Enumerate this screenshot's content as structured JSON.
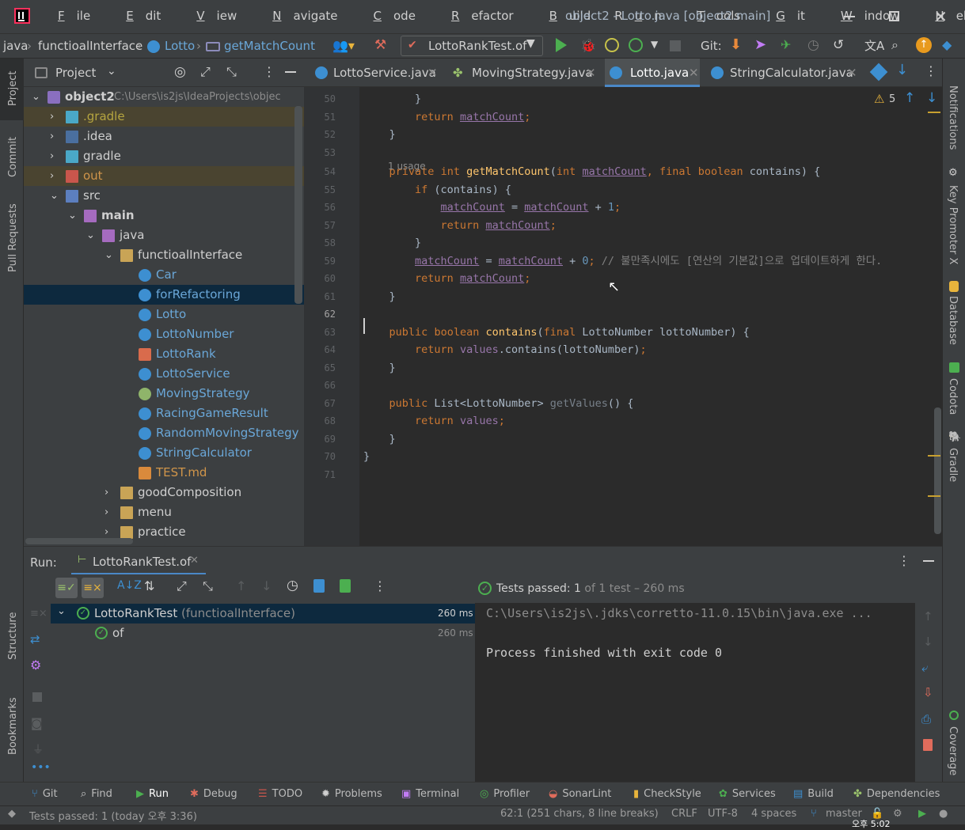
{
  "window": {
    "title": "object2 - Lotto.java [object2.main]",
    "menu": [
      {
        "pre": "",
        "u": "F",
        "post": "ile"
      },
      {
        "pre": "",
        "u": "E",
        "post": "dit"
      },
      {
        "pre": "",
        "u": "V",
        "post": "iew"
      },
      {
        "pre": "",
        "u": "N",
        "post": "avigate"
      },
      {
        "pre": "",
        "u": "C",
        "post": "ode"
      },
      {
        "pre": "",
        "u": "R",
        "post": "efactor"
      },
      {
        "pre": "",
        "u": "B",
        "post": "uild"
      },
      {
        "pre": "R",
        "u": "u",
        "post": "n"
      },
      {
        "pre": "",
        "u": "T",
        "post": "ools"
      },
      {
        "pre": "",
        "u": "G",
        "post": "it"
      },
      {
        "pre": "",
        "u": "W",
        "post": "indow"
      },
      {
        "pre": "",
        "u": "H",
        "post": "elp"
      }
    ]
  },
  "navbar": {
    "crumbs": [
      "java",
      "functioalInterface",
      "Lotto",
      "getMatchCount"
    ],
    "run_config": "LottoRankTest.of",
    "git_label": "Git:"
  },
  "left_strip": {
    "project": "Project",
    "commit": "Commit",
    "pull_requests": "Pull Requests",
    "structure": "Structure",
    "bookmarks": "Bookmarks"
  },
  "right_strip": {
    "notifications": "Notifications",
    "key_promoter": "Key Promoter X",
    "database": "Database",
    "codota": "Codota",
    "gradle": "Gradle",
    "coverage": "Coverage"
  },
  "project": {
    "title": "Project",
    "tree": [
      {
        "label": "object2",
        "suffix": "C:\\Users\\is2js\\IdeaProjects\\objec",
        "bold": true,
        "indent": 0,
        "arrow": "down",
        "icon": "module",
        "color": "#cfcfcf"
      },
      {
        "label": ".gradle",
        "indent": 1,
        "arrow": "right",
        "icon": "folder-teal",
        "color": "#b5a540",
        "excluded": true
      },
      {
        "label": ".idea",
        "indent": 1,
        "arrow": "right",
        "icon": "folder-idea",
        "color": "#cfcfcf"
      },
      {
        "label": "gradle",
        "indent": 1,
        "arrow": "right",
        "icon": "folder-teal",
        "color": "#cfcfcf"
      },
      {
        "label": "out",
        "indent": 1,
        "arrow": "right",
        "icon": "folder-red",
        "color": "#d0954a",
        "excluded": true
      },
      {
        "label": "src",
        "indent": 1,
        "arrow": "down",
        "icon": "folder-src",
        "color": "#cfcfcf"
      },
      {
        "label": "main",
        "indent": 2,
        "arrow": "down",
        "icon": "folder-main",
        "color": "#cfcfcf",
        "bold": true
      },
      {
        "label": "java",
        "indent": 3,
        "arrow": "down",
        "icon": "folder-java",
        "color": "#cfcfcf"
      },
      {
        "label": "functioalInterface",
        "indent": 4,
        "arrow": "down",
        "icon": "folder",
        "color": "#cfcfcf"
      },
      {
        "label": "Car",
        "indent": 5,
        "icon": "class",
        "color": "#6aa7d8"
      },
      {
        "label": "forRefactoring",
        "indent": 5,
        "icon": "class",
        "color": "#6aa7d8",
        "selected": true
      },
      {
        "label": "Lotto",
        "indent": 5,
        "icon": "class",
        "color": "#6aa7d8"
      },
      {
        "label": "LottoNumber",
        "indent": 5,
        "icon": "class",
        "color": "#6aa7d8"
      },
      {
        "label": "LottoRank",
        "indent": 5,
        "icon": "enum",
        "color": "#6aa7d8"
      },
      {
        "label": "LottoService",
        "indent": 5,
        "icon": "class",
        "color": "#6aa7d8"
      },
      {
        "label": "MovingStrategy",
        "indent": 5,
        "icon": "interface",
        "color": "#6aa7d8"
      },
      {
        "label": "RacingGameResult",
        "indent": 5,
        "icon": "class",
        "color": "#6aa7d8"
      },
      {
        "label": "RandomMovingStrategy",
        "indent": 5,
        "icon": "class",
        "color": "#6aa7d8"
      },
      {
        "label": "StringCalculator",
        "indent": 5,
        "icon": "class",
        "color": "#6aa7d8"
      },
      {
        "label": "TEST.md",
        "indent": 5,
        "icon": "md",
        "color": "#d0954a"
      },
      {
        "label": "goodComposition",
        "indent": 4,
        "arrow": "right",
        "icon": "folder",
        "color": "#cfcfcf"
      },
      {
        "label": "menu",
        "indent": 4,
        "arrow": "right",
        "icon": "folder",
        "color": "#cfcfcf"
      },
      {
        "label": "practice",
        "indent": 4,
        "arrow": "right",
        "icon": "folder",
        "color": "#cfcfcf"
      }
    ]
  },
  "editor": {
    "tabs": [
      {
        "label": "LottoService.java",
        "icon": "class",
        "active": false
      },
      {
        "label": "MovingStrategy.java",
        "icon": "interface",
        "active": false
      },
      {
        "label": "Lotto.java",
        "icon": "class",
        "active": true
      },
      {
        "label": "StringCalculator.java",
        "icon": "class",
        "active": false
      }
    ],
    "warnings": "5",
    "usage_hint": "1 usage",
    "lines": [
      {
        "n": "50",
        "tokens": [
          [
            "        }",
            ""
          ]
        ]
      },
      {
        "n": "51",
        "tokens": [
          [
            "        ",
            ""
          ],
          [
            "return",
            "kw"
          ],
          [
            " ",
            ""
          ],
          [
            "matchCount",
            "ul"
          ],
          [
            ";",
            "kw"
          ]
        ]
      },
      {
        "n": "52",
        "tokens": [
          [
            "    }",
            ""
          ]
        ]
      },
      {
        "n": "53",
        "tokens": []
      },
      {
        "n": "54",
        "tokens": [
          [
            "    ",
            ""
          ],
          [
            "private",
            "kw"
          ],
          [
            " ",
            ""
          ],
          [
            "int",
            "kw"
          ],
          [
            " ",
            ""
          ],
          [
            "getMatchCount",
            "fn"
          ],
          [
            "(",
            ""
          ],
          [
            "int",
            "kw"
          ],
          [
            " ",
            ""
          ],
          [
            "matchCount",
            "ul"
          ],
          [
            ", ",
            "kw"
          ],
          [
            "final",
            "kw"
          ],
          [
            " ",
            ""
          ],
          [
            "boolean",
            "kw"
          ],
          [
            " contains) {",
            ""
          ]
        ]
      },
      {
        "n": "55",
        "tokens": [
          [
            "        ",
            ""
          ],
          [
            "if",
            "kw"
          ],
          [
            " (contains) {",
            ""
          ]
        ]
      },
      {
        "n": "56",
        "tokens": [
          [
            "            ",
            ""
          ],
          [
            "matchCount",
            "ul"
          ],
          [
            " = ",
            ""
          ],
          [
            "matchCount",
            "ul"
          ],
          [
            " + ",
            ""
          ],
          [
            "1",
            "num"
          ],
          [
            ";",
            "kw"
          ]
        ]
      },
      {
        "n": "57",
        "tokens": [
          [
            "            ",
            ""
          ],
          [
            "return",
            "kw"
          ],
          [
            " ",
            ""
          ],
          [
            "matchCount",
            "ul"
          ],
          [
            ";",
            "kw"
          ]
        ]
      },
      {
        "n": "58",
        "tokens": [
          [
            "        }",
            ""
          ]
        ]
      },
      {
        "n": "59",
        "tokens": [
          [
            "        ",
            ""
          ],
          [
            "matchCount",
            "ul"
          ],
          [
            " = ",
            ""
          ],
          [
            "matchCount",
            "ul"
          ],
          [
            " + ",
            ""
          ],
          [
            "0",
            "num"
          ],
          [
            "; ",
            "kw"
          ],
          [
            "// 불만족시에도 [연산의 기본값]으로 업데이트하게 한다.",
            "cm"
          ]
        ]
      },
      {
        "n": "60",
        "tokens": [
          [
            "        ",
            ""
          ],
          [
            "return",
            "kw"
          ],
          [
            " ",
            ""
          ],
          [
            "matchCount",
            "ul"
          ],
          [
            ";",
            "kw"
          ]
        ]
      },
      {
        "n": "61",
        "tokens": [
          [
            "    }",
            ""
          ]
        ]
      },
      {
        "n": "62",
        "tokens": []
      },
      {
        "n": "63",
        "tokens": [
          [
            "    ",
            ""
          ],
          [
            "public",
            "kw"
          ],
          [
            " ",
            ""
          ],
          [
            "boolean",
            "kw"
          ],
          [
            " ",
            ""
          ],
          [
            "contains",
            "fn"
          ],
          [
            "(",
            ""
          ],
          [
            "final",
            "kw"
          ],
          [
            " LottoNumber lottoNumber) {",
            ""
          ]
        ]
      },
      {
        "n": "64",
        "tokens": [
          [
            "        ",
            ""
          ],
          [
            "return",
            "kw"
          ],
          [
            " ",
            ""
          ],
          [
            "values",
            "field"
          ],
          [
            ".contains(lottoNumber)",
            ""
          ],
          [
            ";",
            "kw"
          ]
        ]
      },
      {
        "n": "65",
        "tokens": [
          [
            "    }",
            ""
          ]
        ]
      },
      {
        "n": "66",
        "tokens": []
      },
      {
        "n": "67",
        "tokens": [
          [
            "    ",
            ""
          ],
          [
            "public",
            "kw"
          ],
          [
            " List<LottoNumber> ",
            ""
          ],
          [
            "getValues",
            "cm2"
          ],
          [
            "() {",
            ""
          ]
        ]
      },
      {
        "n": "68",
        "tokens": [
          [
            "        ",
            ""
          ],
          [
            "return",
            "kw"
          ],
          [
            " ",
            ""
          ],
          [
            "values",
            "field"
          ],
          [
            ";",
            "kw"
          ]
        ]
      },
      {
        "n": "69",
        "tokens": [
          [
            "    }",
            ""
          ]
        ]
      },
      {
        "n": "70",
        "tokens": [
          [
            "}",
            ""
          ]
        ]
      },
      {
        "n": "71",
        "tokens": []
      }
    ]
  },
  "run": {
    "label": "Run:",
    "tab": "LottoRankTest.of",
    "tests_passed_prefix": "Tests passed: ",
    "tests_passed_count": "1",
    "tests_passed_suffix": " of 1 test – 260 ms",
    "tree": [
      {
        "label": "LottoRankTest",
        "suffix": " (functioalInterface)",
        "time": "260 ms"
      },
      {
        "label": "of",
        "suffix": "",
        "time": "260 ms"
      }
    ],
    "console": [
      "C:\\Users\\is2js\\.jdks\\corretto-11.0.15\\bin\\java.exe ...",
      "",
      "Process finished with exit code 0"
    ]
  },
  "bottom_tools": [
    "Git",
    "Find",
    "Run",
    "Debug",
    "TODO",
    "Problems",
    "Terminal",
    "Profiler",
    "SonarLint",
    "CheckStyle",
    "Services",
    "Build",
    "Dependencies"
  ],
  "status": {
    "left": "Tests passed: 1 (today 오후 3:36)",
    "position": "62:1 (251 chars, 8 line breaks)",
    "line_sep": "CRLF",
    "encoding": "UTF-8",
    "indent": "4 spaces",
    "branch": "master",
    "clock": "오후 5:02"
  }
}
